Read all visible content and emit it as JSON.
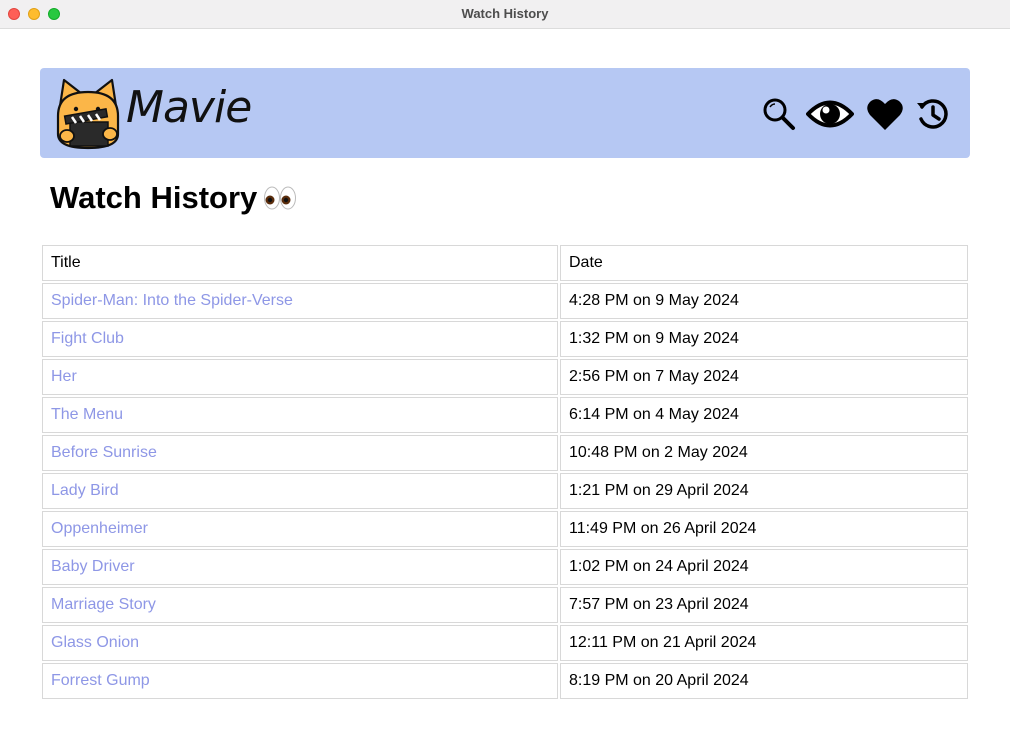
{
  "window": {
    "title": "Watch History"
  },
  "navbar": {
    "brand": "Mavie",
    "icons": [
      "search-icon",
      "eye-icon",
      "heart-icon",
      "history-icon"
    ],
    "background": "#b6c8f3"
  },
  "page": {
    "title": "Watch History",
    "title_emoji": "eyes-icon"
  },
  "table": {
    "headers": {
      "title": "Title",
      "date": "Date"
    },
    "rows": [
      {
        "title": "Spider-Man: Into the Spider-Verse",
        "date": "4:28 PM on 9 May 2024"
      },
      {
        "title": "Fight Club",
        "date": "1:32 PM on 9 May 2024"
      },
      {
        "title": "Her",
        "date": "2:56 PM on 7 May 2024"
      },
      {
        "title": "The Menu",
        "date": "6:14 PM on 4 May 2024"
      },
      {
        "title": "Before Sunrise",
        "date": "10:48 PM on 2 May 2024"
      },
      {
        "title": "Lady Bird",
        "date": "1:21 PM on 29 April 2024"
      },
      {
        "title": "Oppenheimer",
        "date": "11:49 PM on 26 April 2024"
      },
      {
        "title": "Baby Driver",
        "date": "1:02 PM on 24 April 2024"
      },
      {
        "title": "Marriage Story",
        "date": "7:57 PM on 23 April 2024"
      },
      {
        "title": "Glass Onion",
        "date": "12:11 PM on 21 April 2024"
      },
      {
        "title": "Forrest Gump",
        "date": "8:19 PM on 20 April 2024"
      }
    ],
    "link_color": "#8e97e6"
  }
}
